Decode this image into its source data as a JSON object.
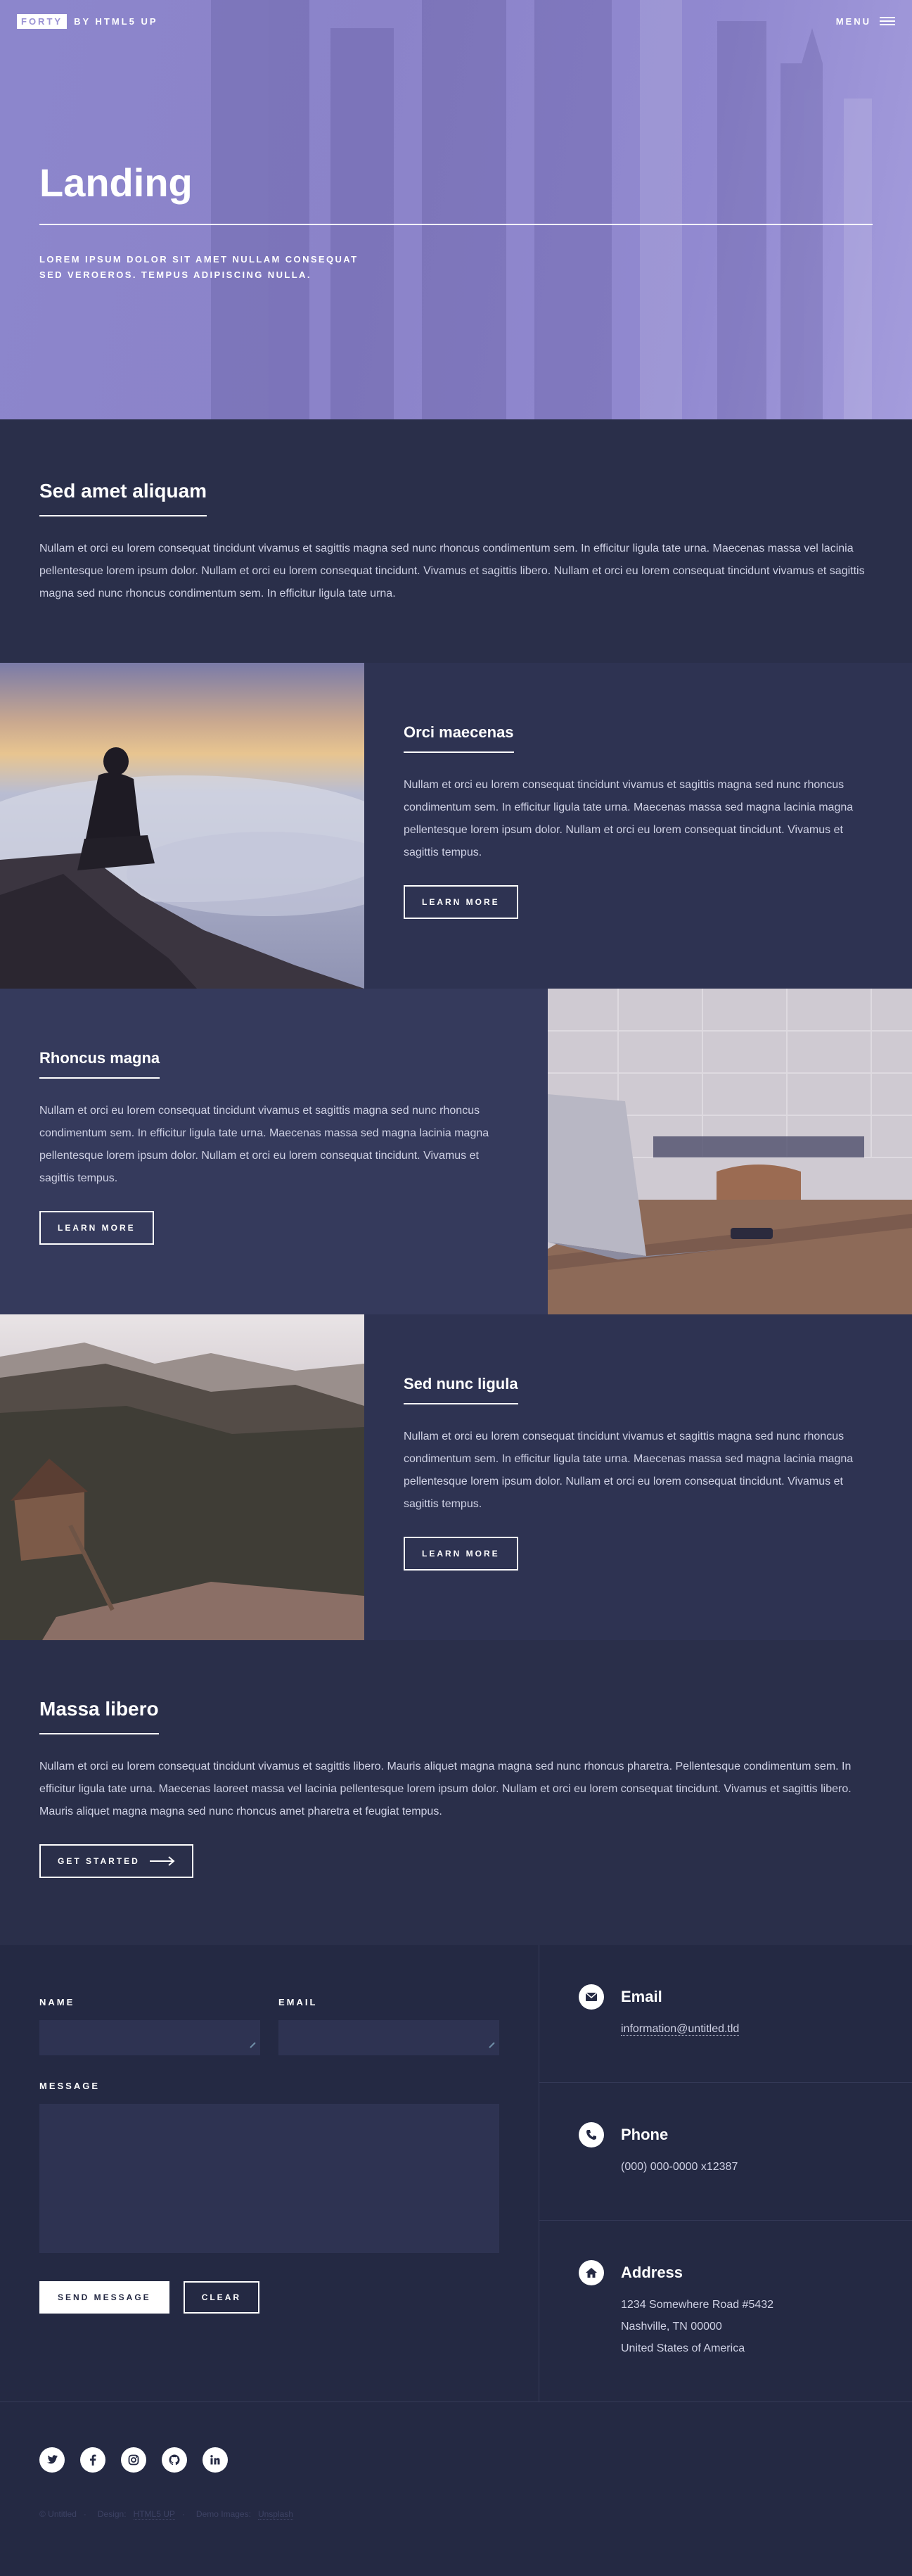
{
  "header": {
    "logo_box": "FORTY",
    "logo_text": "BY HTML5 UP",
    "menu_label": "MENU"
  },
  "banner": {
    "title": "Landing",
    "subtitle_line1": "LOREM IPSUM DOLOR SIT AMET NULLAM CONSEQUAT",
    "subtitle_line2": "SED VEROEROS. TEMPUS ADIPISCING NULLA."
  },
  "intro": {
    "heading": "Sed amet aliquam",
    "text": "Nullam et orci eu lorem consequat tincidunt vivamus et sagittis magna sed nunc rhoncus condimentum sem. In efficitur ligula tate urna. Maecenas massa vel lacinia pellentesque lorem ipsum dolor. Nullam et orci eu lorem consequat tincidunt. Vivamus et sagittis libero. Nullam et orci eu lorem consequat tincidunt vivamus et sagittis magna sed nunc rhoncus condimentum sem. In efficitur ligula tate urna."
  },
  "spotlights": [
    {
      "title": "Orci maecenas",
      "text": "Nullam et orci eu lorem consequat tincidunt vivamus et sagittis magna sed nunc rhoncus condimentum sem. In efficitur ligula tate urna. Maecenas massa sed magna lacinia magna pellentesque lorem ipsum dolor. Nullam et orci eu lorem consequat tincidunt. Vivamus et sagittis tempus.",
      "button": "LEARN MORE"
    },
    {
      "title": "Rhoncus magna",
      "text": "Nullam et orci eu lorem consequat tincidunt vivamus et sagittis magna sed nunc rhoncus condimentum sem. In efficitur ligula tate urna. Maecenas massa sed magna lacinia magna pellentesque lorem ipsum dolor. Nullam et orci eu lorem consequat tincidunt. Vivamus et sagittis tempus.",
      "button": "LEARN MORE"
    },
    {
      "title": "Sed nunc ligula",
      "text": "Nullam et orci eu lorem consequat tincidunt vivamus et sagittis magna sed nunc rhoncus condimentum sem. In efficitur ligula tate urna. Maecenas massa sed magna lacinia magna pellentesque lorem ipsum dolor. Nullam et orci eu lorem consequat tincidunt. Vivamus et sagittis tempus.",
      "button": "LEARN MORE"
    }
  ],
  "massa": {
    "heading": "Massa libero",
    "text": "Nullam et orci eu lorem consequat tincidunt vivamus et sagittis libero. Mauris aliquet magna magna sed nunc rhoncus pharetra. Pellentesque condimentum sem. In efficitur ligula tate urna. Maecenas laoreet massa vel lacinia pellentesque lorem ipsum dolor. Nullam et orci eu lorem consequat tincidunt. Vivamus et sagittis libero. Mauris aliquet magna magna sed nunc rhoncus amet pharetra et feugiat tempus.",
    "button": "GET STARTED"
  },
  "form": {
    "name_label": "NAME",
    "email_label": "EMAIL",
    "message_label": "MESSAGE",
    "send_label": "SEND MESSAGE",
    "clear_label": "CLEAR"
  },
  "contact": {
    "email_title": "Email",
    "email_value": "information@untitled.tld",
    "phone_title": "Phone",
    "phone_value": "(000) 000-0000 x12387",
    "address_title": "Address",
    "address_line1": "1234 Somewhere Road #5432",
    "address_line2": "Nashville, TN 00000",
    "address_line3": "United States of America"
  },
  "footer": {
    "social_icons": [
      "twitter-icon",
      "facebook-icon",
      "instagram-icon",
      "github-icon",
      "linkedin-icon"
    ],
    "copyright": "© Untitled",
    "design_label": "Design:",
    "design_link": "HTML5 UP",
    "images_label": "Demo Images:",
    "images_link": "Unsplash"
  },
  "colors": {
    "banner_accent": "#8c86cc",
    "page_bg": "#242943",
    "panel_bg": "#2e3352",
    "alt_panel_bg": "#353a5c"
  }
}
